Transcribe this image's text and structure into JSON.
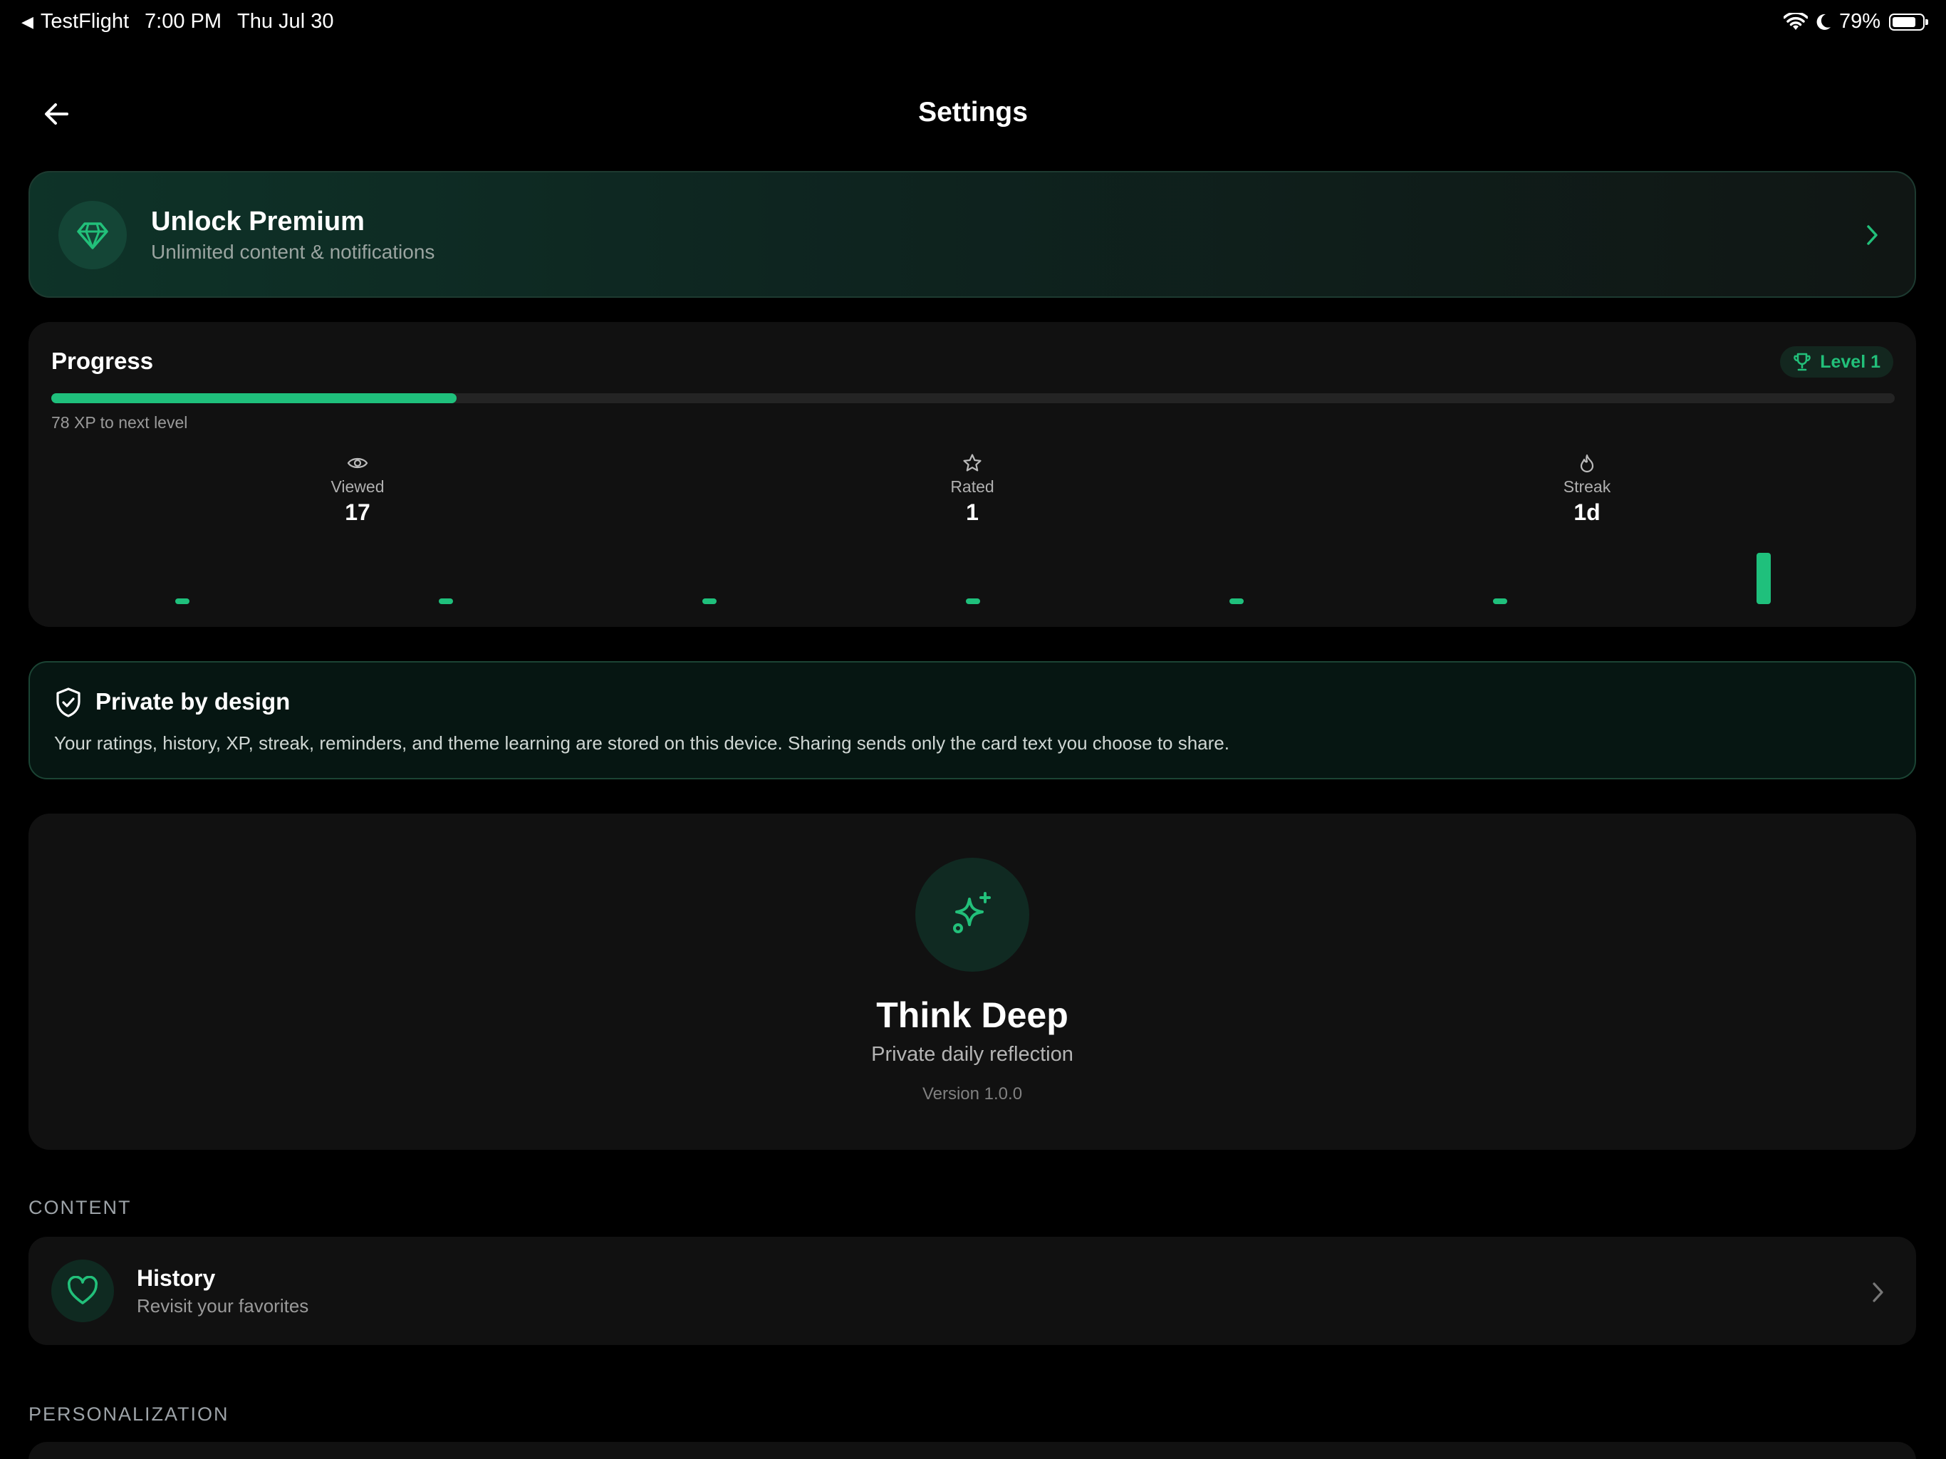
{
  "status_bar": {
    "back_app": "TestFlight",
    "time": "7:00 PM",
    "date": "Thu Jul 30",
    "battery_text": "79%",
    "battery_level": 0.79
  },
  "header": {
    "title": "Settings",
    "back_icon": "arrow-left-icon"
  },
  "premium": {
    "icon": "diamond-icon",
    "title": "Unlock Premium",
    "subtitle": "Unlimited content & notifications"
  },
  "progress": {
    "title": "Progress",
    "level_label": "Level 1",
    "xp_fraction": 0.22,
    "xp_text": "78 XP to next level",
    "stats": [
      {
        "icon": "eye-icon",
        "label": "Viewed",
        "value": "17"
      },
      {
        "icon": "star-icon",
        "label": "Rated",
        "value": "1"
      },
      {
        "icon": "flame-icon",
        "label": "Streak",
        "value": "1d"
      }
    ],
    "activity": [
      0,
      0,
      0,
      0,
      0,
      0,
      1
    ]
  },
  "privacy": {
    "icon": "shield-check-icon",
    "title": "Private by design",
    "body": "Your ratings, history, XP, streak, reminders, and theme learning are stored on this device. Sharing sends only the card text you choose to share."
  },
  "about": {
    "icon": "sparkles-icon",
    "app_name": "Think Deep",
    "tagline": "Private daily reflection",
    "version": "Version 1.0.0"
  },
  "sections": {
    "content_header": "CONTENT",
    "personalization_header": "PERSONALIZATION"
  },
  "history_row": {
    "icon": "heart-icon",
    "title": "History",
    "subtitle": "Revisit your favorites"
  },
  "colors": {
    "accent": "#1fc07c",
    "background": "#000000",
    "card": "#111111"
  }
}
